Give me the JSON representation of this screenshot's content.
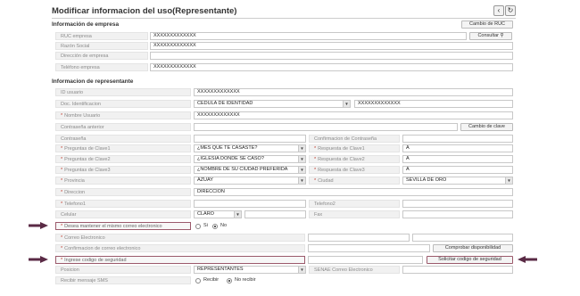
{
  "header": {
    "title": "Modificar informacion del uso(Representante)",
    "back_icon": "‹",
    "refresh_icon": "↻"
  },
  "empresa": {
    "section_title": "Información de empresa",
    "change_ruc_label": "Cambio de RUC",
    "ruc_label": "RUC empresa",
    "ruc_value": "XXXXXXXXXXXXX",
    "consultar_label": "Consultar",
    "razon_label": "Razón Social",
    "razon_value": "XXXXXXXXXXXXX",
    "direccion_label": "Dirección de empresa",
    "direccion_value": "",
    "telefono_label": "Teléfono empresa",
    "telefono_value": "XXXXXXXXXXXXX"
  },
  "representante": {
    "section_title": "Informacion de representante",
    "id_label": "ID usuario",
    "id_value": "XXXXXXXXXXXXX",
    "doc_label": "Doc. Identificacion",
    "doc_type": "CEDULA DE IDENTIDAD",
    "doc_value": "XXXXXXXXXXXXX",
    "nombre_label": "Nombre Usuario",
    "nombre_value": "XXXXXXXXXXXXX",
    "pass_prev_label": "Contraseña anterior",
    "cambio_clave_label": "Cambio de clave",
    "pass_label": "Contraseña",
    "pass_confirm_label": "Confirmacion de Contraseña",
    "preg1_label": "Preguntas de Clave1",
    "preg1_value": "¿MES QUE TE CASASTE?",
    "resp1_label": "Respuesta de Clave1",
    "resp1_value": "A",
    "preg2_label": "Preguntas de Clave2",
    "preg2_value": "¿IGLESIA DONDE SE CASO?",
    "resp2_label": "Respuesta de Clave2",
    "resp2_value": "A",
    "preg3_label": "Preguntas de Clave3",
    "preg3_value": "¿NOMBRE DE SU CIUDAD PREFERIDA",
    "resp3_label": "Respuesta de Clave3",
    "resp3_value": "A",
    "provincia_label": "Provincia",
    "provincia_value": "AZUAY",
    "ciudad_label": "Ciudad",
    "ciudad_value": "SEVILLA DE ORO",
    "direccion_label": "Direccion",
    "direccion_value": "DIRECCION",
    "tel1_label": "Telefono1",
    "tel2_label": "Telefono2",
    "celular_label": "Celular",
    "celular_op": "CLARO",
    "fax_label": "Fax",
    "mismo_correo_label": "Desea mantener el mismo correo electronico",
    "si_label": "Si",
    "no_label": "No",
    "correo_label": "Correo Electronico",
    "confirm_correo_label": "Confirmacion de correo electronico",
    "comprobar_label": "Comprobar disponibilidad",
    "codigo_label": "Ingrese codigo de seguridad",
    "solicitar_label": "Solicitar codigo de seguridad",
    "posicion_label": "Posicion",
    "posicion_value": "REPRESENTANTES",
    "senae_label": "SENAE Correo Electronico",
    "sms_label": "Recibir mensaje SMS",
    "recibir_label": "Recibir",
    "no_recibir_label": "No recibir"
  },
  "colors": {
    "highlight_border": "#9b5a6b",
    "arrow": "#5a2a45",
    "required": "#c0392b"
  }
}
